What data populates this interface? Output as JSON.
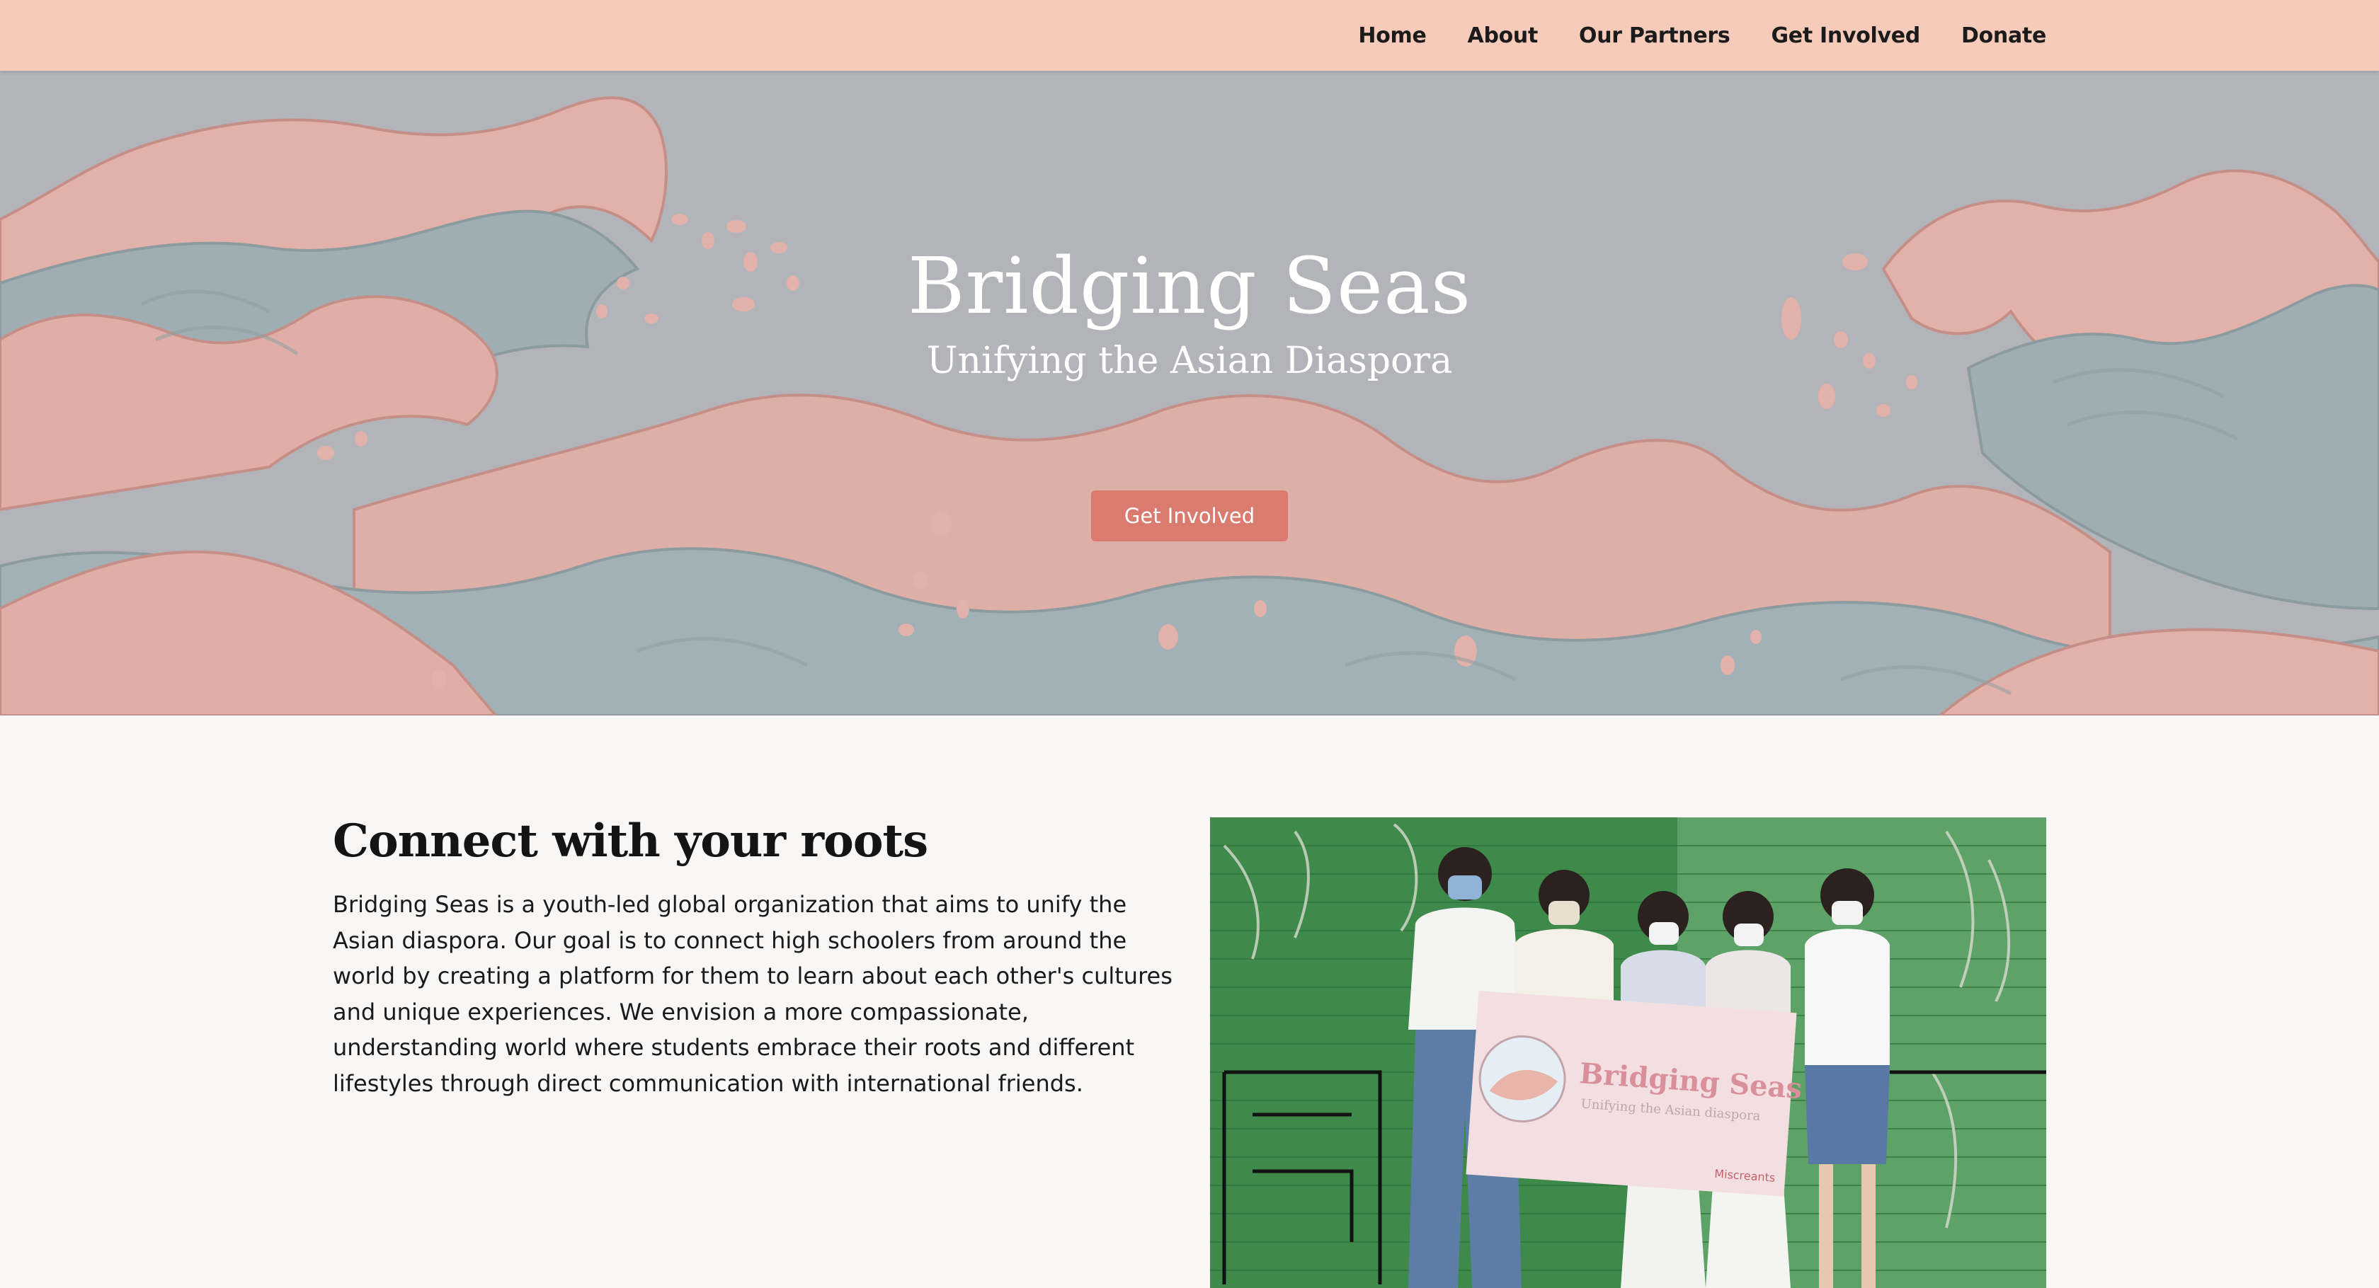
{
  "nav": {
    "items": [
      {
        "label": "Home"
      },
      {
        "label": "About"
      },
      {
        "label": "Our Partners"
      },
      {
        "label": "Get Involved"
      },
      {
        "label": "Donate"
      }
    ]
  },
  "hero": {
    "title": "Bridging Seas",
    "subtitle": "Unifying the Asian Diaspora",
    "button_label": "Get Involved"
  },
  "about": {
    "heading": "Connect with your roots",
    "body": "Bridging Seas is a youth-led global organization that aims to unify the Asian diaspora. Our goal is to connect high schoolers from around the world by creating a platform for them to learn about each other's cultures and unique experiences. We envision a more compassionate, understanding world where students embrace their roots and different lifestyles through direct communication with international friends."
  },
  "photo": {
    "banner_title": "Bridging Seas",
    "banner_subtitle": "Unifying the Asian diaspora",
    "banner_sponsor": "Miscreants"
  },
  "colors": {
    "nav_bg": "#f6cbb9",
    "hero_sky": "#b6b7bc",
    "wave_pink": "#e8b3a9",
    "wave_blue": "#9fb0b4",
    "button": "#d97b6f",
    "page_bg": "#f8f7f5"
  }
}
